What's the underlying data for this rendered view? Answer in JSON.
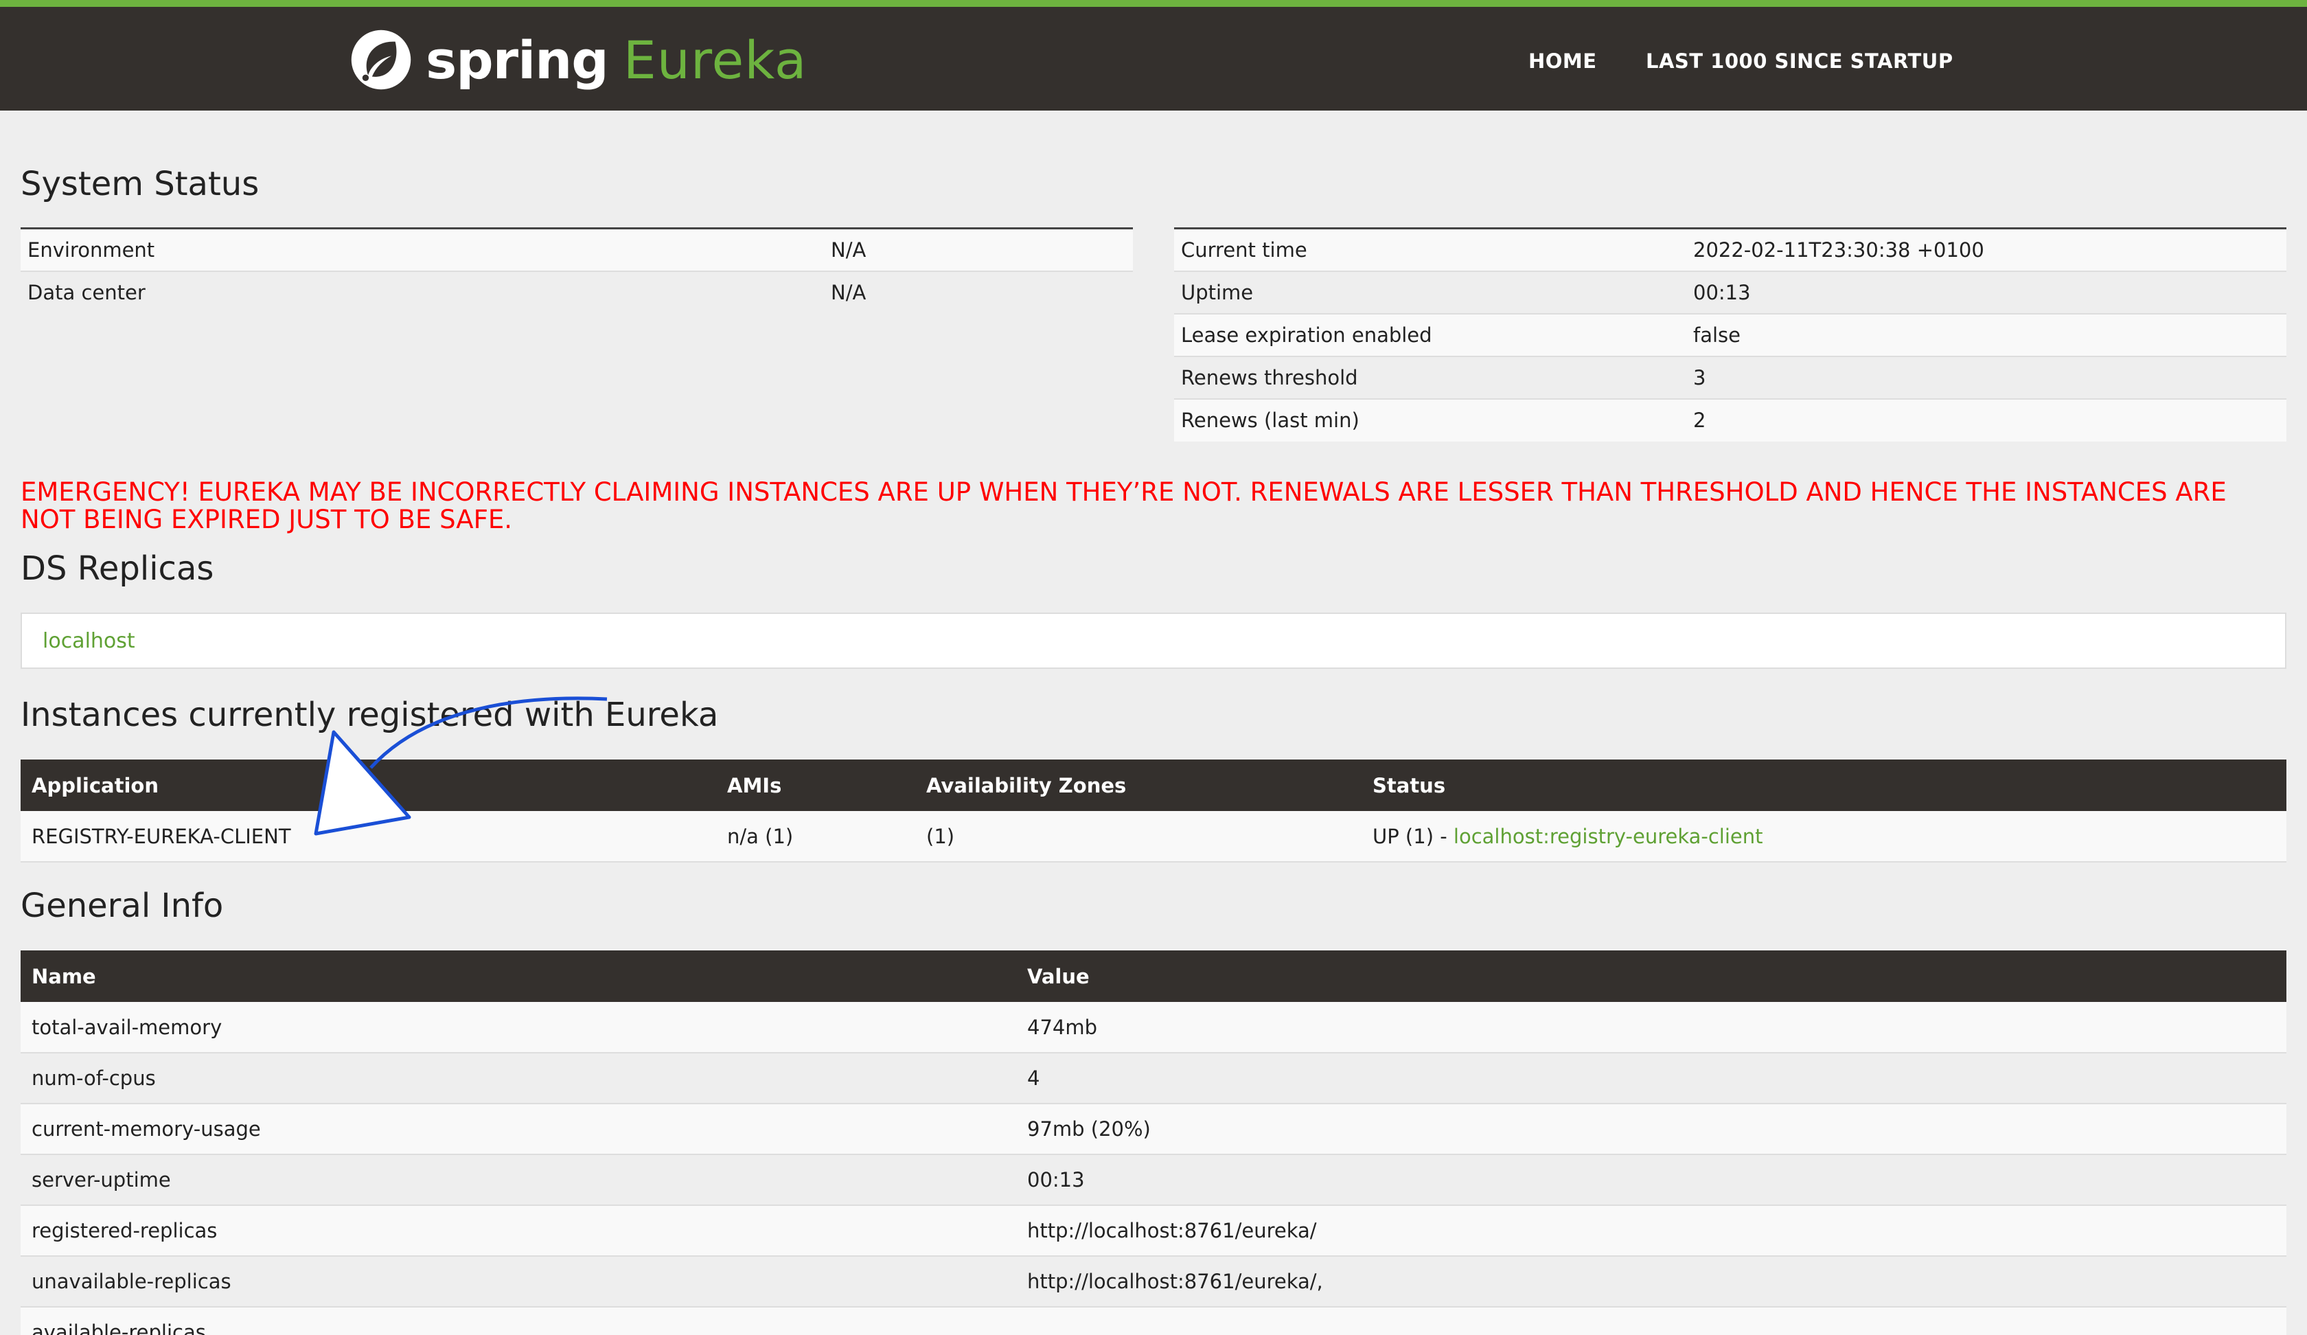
{
  "header": {
    "brand_spring": "spring",
    "brand_eureka": "Eureka",
    "nav": {
      "home": "HOME",
      "last": "LAST 1000 SINCE STARTUP"
    },
    "accent_color": "#6db33f"
  },
  "system_status": {
    "title": "System Status",
    "left": [
      {
        "label": "Environment",
        "value": "N/A"
      },
      {
        "label": "Data center",
        "value": "N/A"
      }
    ],
    "right": [
      {
        "label": "Current time",
        "value": "2022-02-11T23:30:38 +0100"
      },
      {
        "label": "Uptime",
        "value": "00:13"
      },
      {
        "label": "Lease expiration enabled",
        "value": "false"
      },
      {
        "label": "Renews threshold",
        "value": "3"
      },
      {
        "label": "Renews (last min)",
        "value": "2"
      }
    ]
  },
  "emergency": "EMERGENCY! EUREKA MAY BE INCORRECTLY CLAIMING INSTANCES ARE UP WHEN THEY’RE NOT. RENEWALS ARE LESSER THAN THRESHOLD AND HENCE THE INSTANCES ARE NOT BEING EXPIRED JUST TO BE SAFE.",
  "ds_replicas": {
    "title": "DS Replicas",
    "link": "localhost"
  },
  "instances": {
    "title": "Instances currently registered with Eureka",
    "columns": [
      "Application",
      "AMIs",
      "Availability Zones",
      "Status"
    ],
    "rows": [
      {
        "application": "REGISTRY-EUREKA-CLIENT",
        "amis": "n/a (1)",
        "zones": "(1)",
        "status_prefix": "UP (1) - ",
        "status_link": "localhost:registry-eureka-client"
      }
    ]
  },
  "general_info": {
    "title": "General Info",
    "columns": [
      "Name",
      "Value"
    ],
    "rows": [
      {
        "name": "total-avail-memory",
        "value": "474mb"
      },
      {
        "name": "num-of-cpus",
        "value": "4"
      },
      {
        "name": "current-memory-usage",
        "value": "97mb (20%)"
      },
      {
        "name": "server-uptime",
        "value": "00:13"
      },
      {
        "name": "registered-replicas",
        "value": "http://localhost:8761/eureka/"
      },
      {
        "name": "unavailable-replicas",
        "value": "http://localhost:8761/eureka/,"
      },
      {
        "name": "available-replicas",
        "value": ""
      }
    ]
  }
}
